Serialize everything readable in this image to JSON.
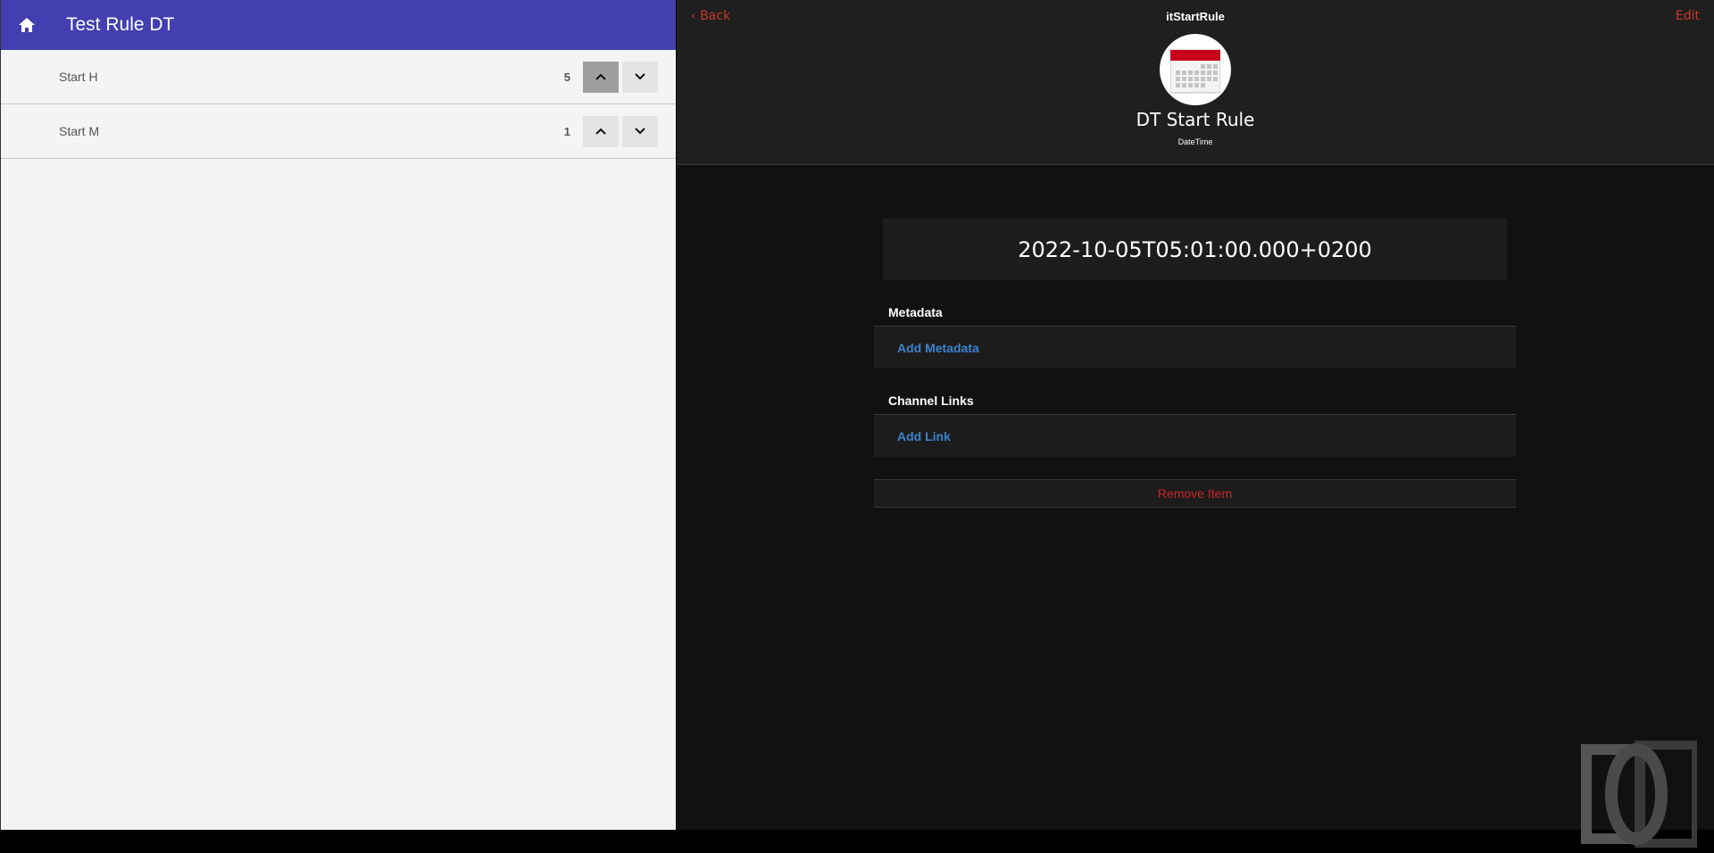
{
  "left": {
    "title": "Test Rule DT",
    "items": [
      {
        "label": "Start H",
        "value": "5"
      },
      {
        "label": "Start M",
        "value": "1"
      }
    ]
  },
  "right": {
    "back": "Back",
    "item_name": "itStartRule",
    "edit": "Edit",
    "label": "DT Start Rule",
    "type": "DateTime",
    "state": "2022-10-05T05:01:00.000+0200",
    "metadata_title": "Metadata",
    "add_metadata": "Add Metadata",
    "links_title": "Channel Links",
    "add_link": "Add Link",
    "remove": "Remove Item"
  },
  "colors": {
    "accent": "#433fb0",
    "danger": "#c9392b",
    "link": "#3d82cf"
  }
}
